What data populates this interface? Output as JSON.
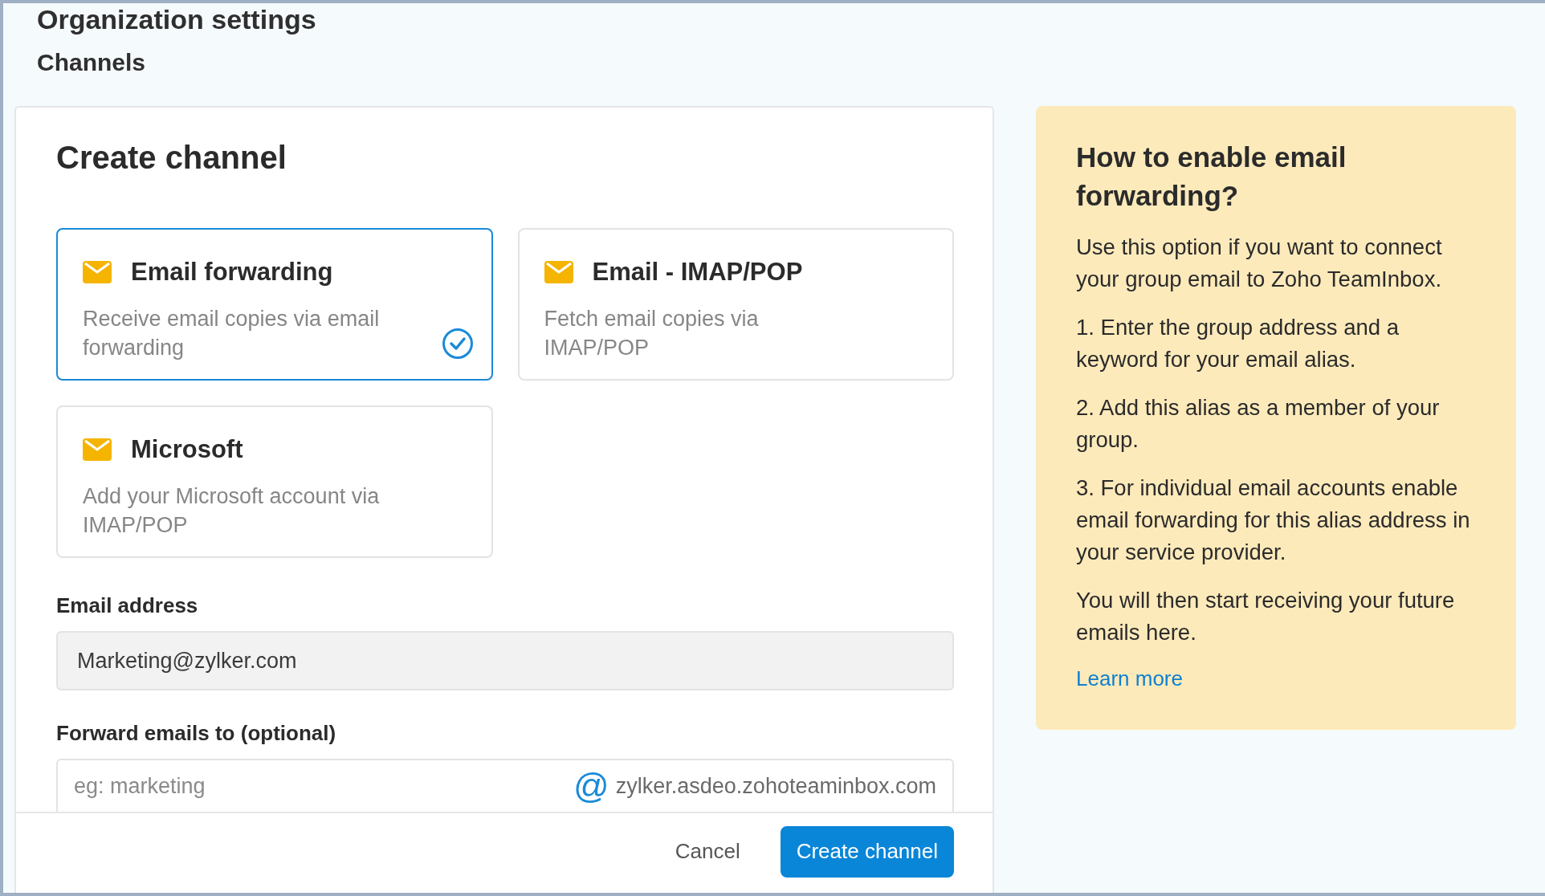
{
  "page": {
    "title": "Organization settings",
    "subtitle": "Channels"
  },
  "form": {
    "title": "Create channel",
    "options": [
      {
        "title": "Email forwarding",
        "description": "Receive email copies via email forwarding",
        "selected": true
      },
      {
        "title": "Email - IMAP/POP",
        "description": "Fetch email copies via IMAP/POP",
        "selected": false
      },
      {
        "title": "Microsoft",
        "description": "Add your Microsoft account via IMAP/POP",
        "selected": false
      }
    ],
    "email_address": {
      "label": "Email address",
      "value": "Marketing@zylker.com"
    },
    "forward_to": {
      "label": "Forward emails to (optional)",
      "placeholder": "eg: marketing",
      "at": "@",
      "domain": "zylker.asdeo.zohoteaminbox.com"
    },
    "buttons": {
      "cancel": "Cancel",
      "submit": "Create channel"
    }
  },
  "help": {
    "title": "How to enable email forwarding?",
    "paragraphs": [
      "Use this option if you want to connect your group email to Zoho TeamInbox.",
      "1. Enter the group address and a keyword for your email alias.",
      "2. Add this alias as a member of your group.",
      "3. For individual email accounts enable email forwarding for this alias address in your service provider.",
      "You will then start receiving your future emails here."
    ],
    "link": "Learn more"
  }
}
